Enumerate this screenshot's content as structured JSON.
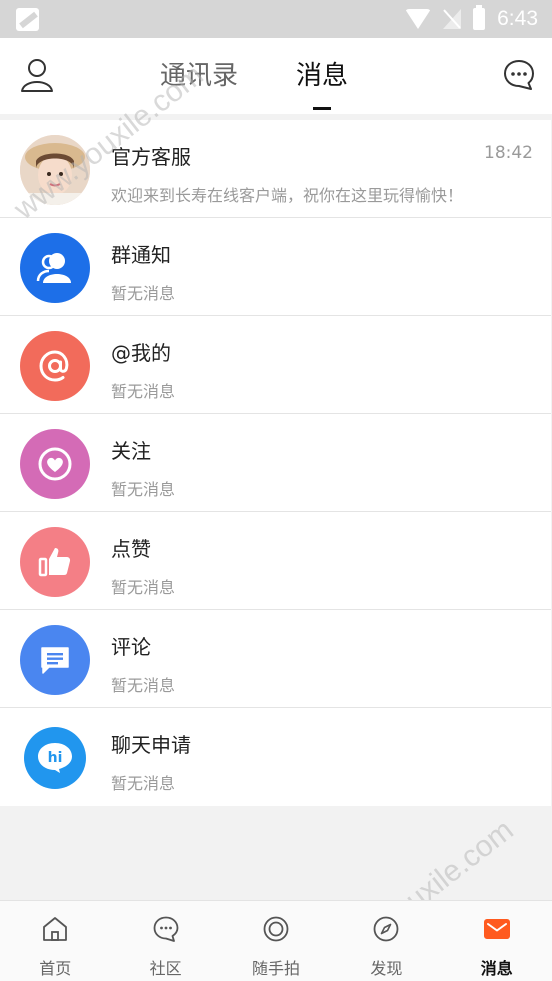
{
  "status_bar": {
    "time": "6:43",
    "icons": [
      "app-notification-icon",
      "wifi-icon",
      "no-signal-icon",
      "battery-charging-icon"
    ]
  },
  "header": {
    "tabs": [
      {
        "label": "通讯录",
        "active": false
      },
      {
        "label": "消息",
        "active": true
      }
    ],
    "left_icon": "user-profile-icon",
    "right_icon": "chat-bubble-icon"
  },
  "messages": [
    {
      "title": "官方客服",
      "subtitle": "欢迎来到长寿在线客户端，祝你在这里玩得愉快！",
      "time": "18:42",
      "icon": "customer-service-avatar",
      "color": "#f3d6c8"
    },
    {
      "title": "群通知",
      "subtitle": "暂无消息",
      "icon": "group-icon",
      "color": "#1d6fe8"
    },
    {
      "title": "@我的",
      "subtitle": "暂无消息",
      "icon": "at-icon",
      "color": "#f26b5b"
    },
    {
      "title": "关注",
      "subtitle": "暂无消息",
      "icon": "heart-icon",
      "color": "#d46bb6"
    },
    {
      "title": "点赞",
      "subtitle": "暂无消息",
      "icon": "thumbs-up-icon",
      "color": "#f47f86"
    },
    {
      "title": "评论",
      "subtitle": "暂无消息",
      "icon": "comment-icon",
      "color": "#4a86f0"
    },
    {
      "title": "聊天申请",
      "subtitle": "暂无消息",
      "icon": "hi-chat-icon",
      "color": "#2196ee"
    }
  ],
  "bottom_nav": [
    {
      "label": "首页",
      "icon": "home-icon",
      "active": false
    },
    {
      "label": "社区",
      "icon": "community-icon",
      "active": false
    },
    {
      "label": "随手拍",
      "icon": "camera-shutter-icon",
      "active": false
    },
    {
      "label": "发现",
      "icon": "compass-icon",
      "active": false
    },
    {
      "label": "消息",
      "icon": "mail-icon",
      "active": true
    }
  ],
  "watermark": "www.youxile.com",
  "accent_color": "#ff5a1f"
}
